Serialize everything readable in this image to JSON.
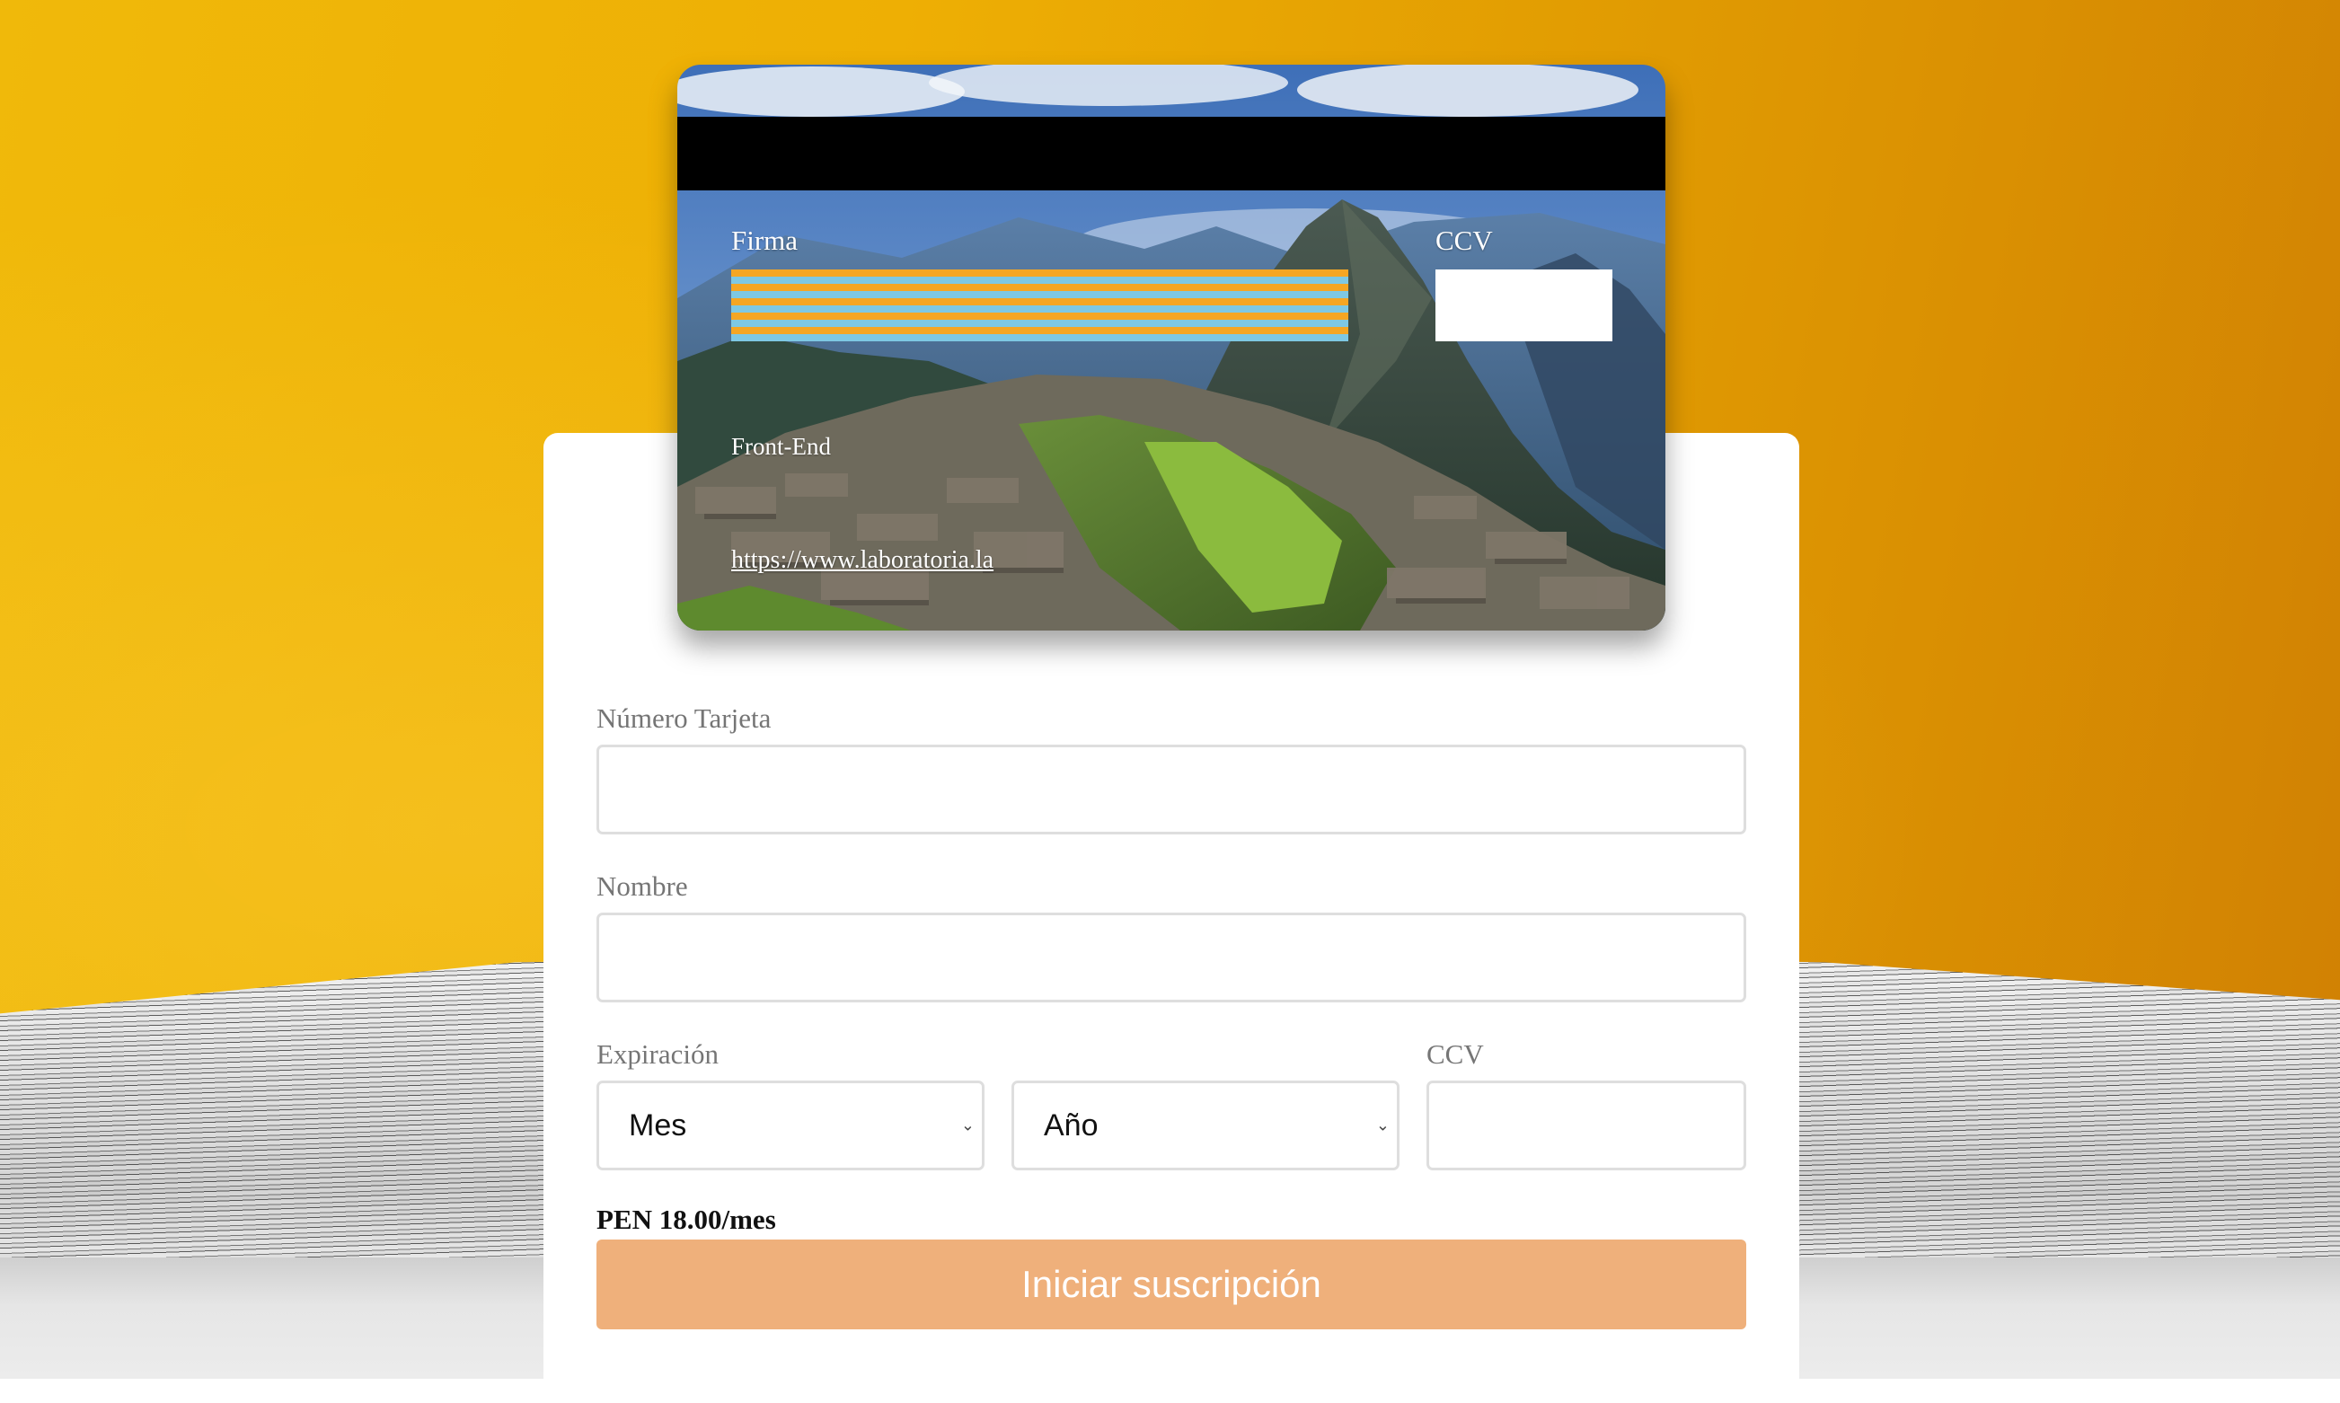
{
  "card": {
    "signature_label": "Firma",
    "ccv_label": "CCV",
    "track_label": "Front-End",
    "link_text": "https://www.laboratoria.la",
    "scene": "machu-picchu-photo"
  },
  "form": {
    "card_number": {
      "label": "Número Tarjeta",
      "value": ""
    },
    "name": {
      "label": "Nombre",
      "value": ""
    },
    "expiration": {
      "label": "Expiración",
      "month_selected": "Mes",
      "year_selected": "Año"
    },
    "ccv": {
      "label": "CCV",
      "value": ""
    },
    "price": "PEN 18.00/mes",
    "submit_label": "Iniciar suscripción"
  },
  "colors": {
    "background_accent": "#eeaf04",
    "button": "#efb07b",
    "signature_stripe_a": "#f5a623",
    "signature_stripe_b": "#7ec8e3"
  }
}
